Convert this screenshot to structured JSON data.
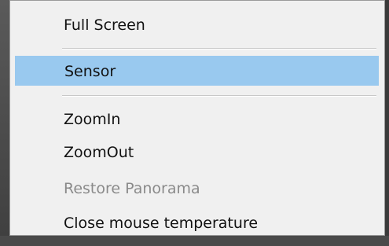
{
  "menu": {
    "items": [
      {
        "label": "Full Screen",
        "state": "normal"
      },
      {
        "label": "Sensor",
        "state": "highlighted"
      },
      {
        "label": "ZoomIn",
        "state": "normal"
      },
      {
        "label": "ZoomOut",
        "state": "normal"
      },
      {
        "label": "Restore Panorama",
        "state": "disabled"
      },
      {
        "label": "Close mouse temperature",
        "state": "normal"
      }
    ]
  },
  "colors": {
    "menu_background": "#f0f0f0",
    "highlight": "#99c9ef",
    "disabled_text": "#8a8a8a",
    "text": "#111111"
  }
}
